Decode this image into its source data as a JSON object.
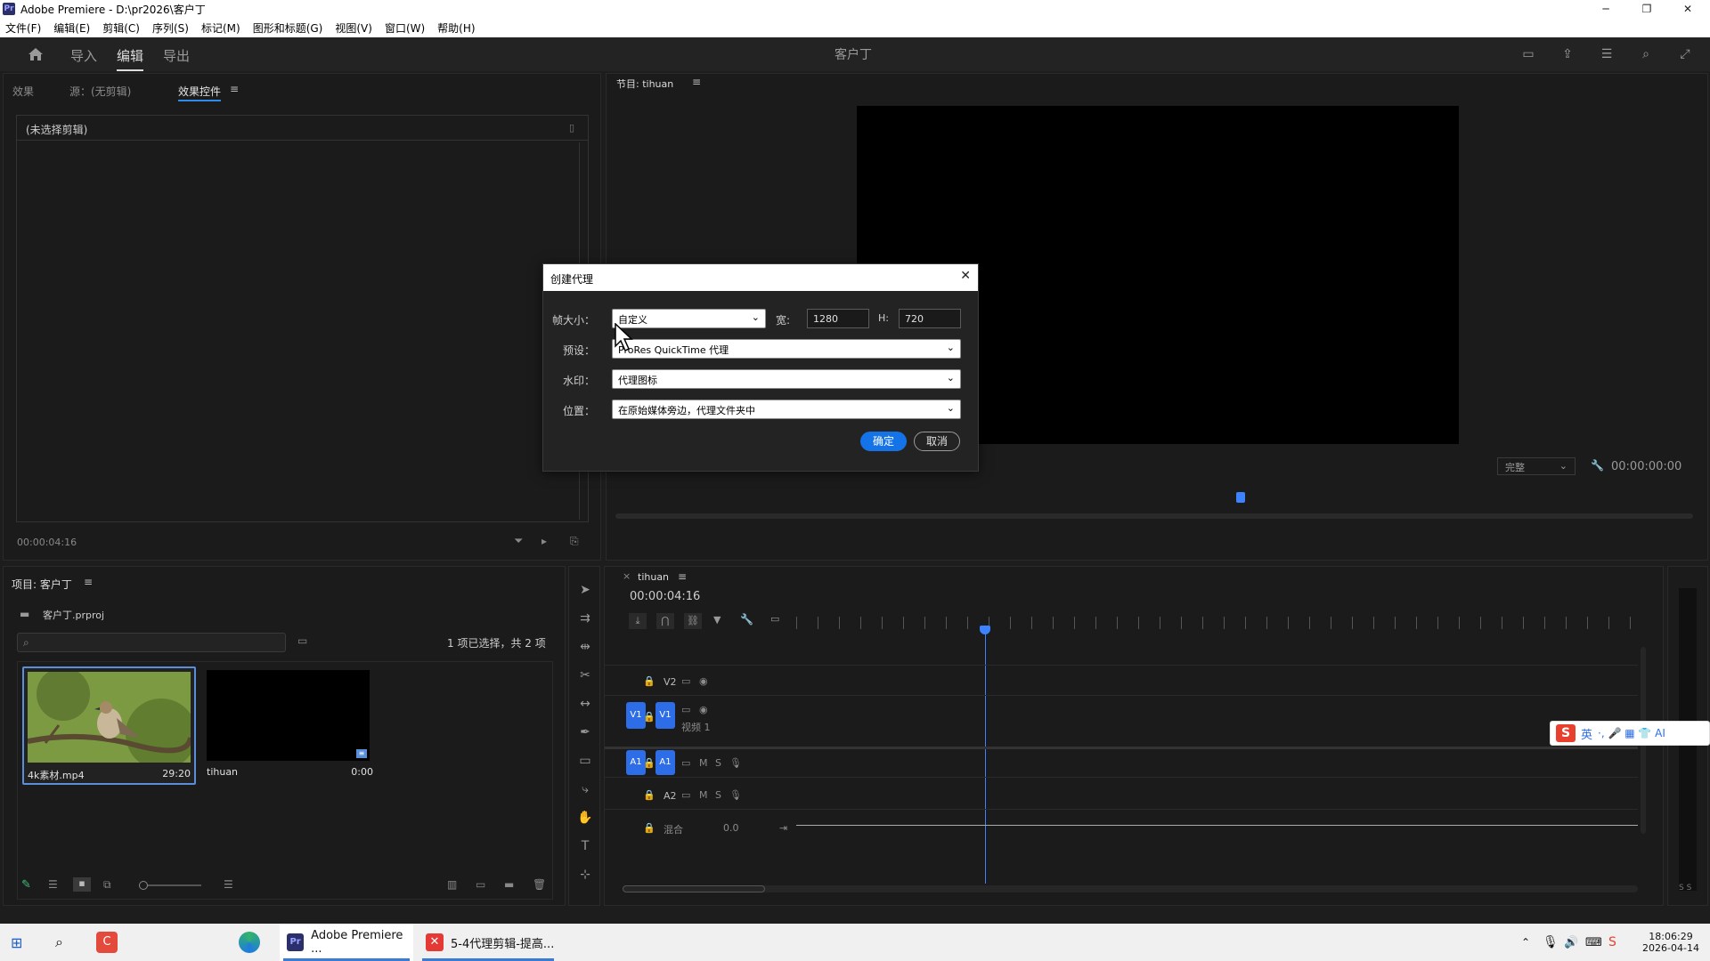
{
  "window": {
    "app_icon": "Pr",
    "title": "Adobe Premiere - D:\\pr2026\\客户丁",
    "minimize": "─",
    "maximize": "❐",
    "close": "✕"
  },
  "menu": [
    "文件(F)",
    "编辑(E)",
    "剪辑(C)",
    "序列(S)",
    "标记(M)",
    "图形和标题(G)",
    "视图(V)",
    "窗口(W)",
    "帮助(H)"
  ],
  "workspace": {
    "home_icon": "home-icon",
    "tabs": [
      "导入",
      "编辑",
      "导出"
    ],
    "active": "编辑",
    "project_title": "客户丁"
  },
  "source_panel": {
    "tabs": [
      "效果",
      "源：(无剪辑)",
      "效果控件"
    ],
    "menu_glyph": "≡",
    "no_clip": "(未选择剪辑)",
    "timecode": "00:00:04:16"
  },
  "program_panel": {
    "title": "节目: tihuan",
    "menu_glyph": "≡",
    "fit": "完整",
    "timecode": "00:00:00:00"
  },
  "dialog": {
    "title": "创建代理",
    "frame_size_label": "帧大小：",
    "frame_size_value": "自定义",
    "width_label": "宽:",
    "width_value": "1280",
    "height_label": "H:",
    "height_value": "720",
    "preset_label": "预设：",
    "preset_value": "ProRes QuickTime 代理",
    "watermark_label": "水印：",
    "watermark_value": "代理图标",
    "location_label": "位置：",
    "location_value": "在原始媒体旁边，代理文件夹中",
    "ok": "确定",
    "cancel": "取消"
  },
  "project_panel": {
    "title": "项目: 客户丁",
    "menu_glyph": "≡",
    "file": "客户丁.prproj",
    "selection": "1 项已选择，共 2 项",
    "items": [
      {
        "name": "4k素材.mp4",
        "duration": "29:20"
      },
      {
        "name": "tihuan",
        "duration": "0:00"
      }
    ]
  },
  "timeline": {
    "sequence": "tihuan",
    "menu_glyph": "≡",
    "timecode": "00:00:04:16",
    "tracks": {
      "v2": "V2",
      "v1": "V1",
      "v1_name": "视频 1",
      "a1": "A1",
      "a2": "A2",
      "mix": "混合",
      "mix_value": "0.0",
      "m": "M",
      "s": "S"
    },
    "right_meter": "S S"
  },
  "ime": {
    "label": "英",
    "glyphs": "·, 🎤 ▦ 👕 AI"
  },
  "taskbar": {
    "premiere": "Adobe Premiere ...",
    "course": "5-4代理剪辑-提高...",
    "time": "18:06:29",
    "date": "2026-04-14"
  },
  "colors": {
    "accent": "#2d6ee8",
    "panel_bg": "#1b1b1b",
    "playhead": "#3d82ff"
  }
}
